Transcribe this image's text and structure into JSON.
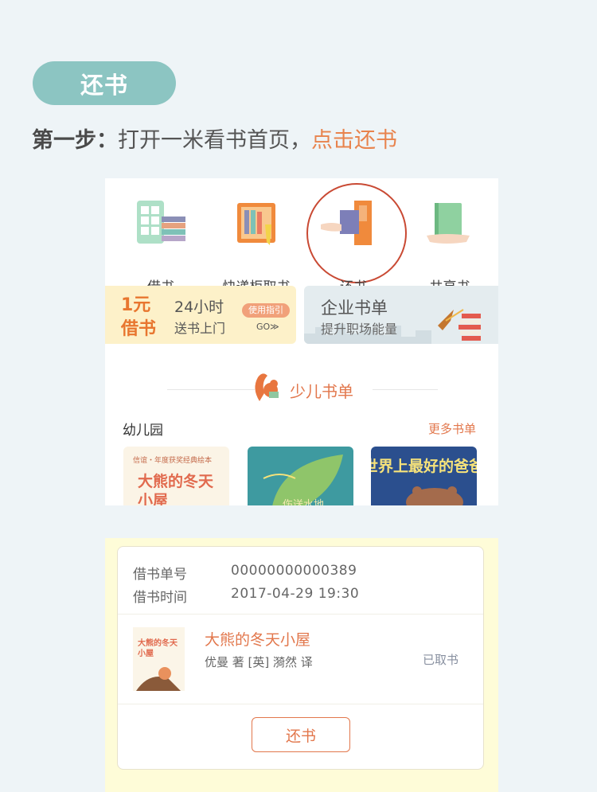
{
  "header": {
    "pill_label": "还书",
    "step_prefix": "第一步：",
    "step_text": "打开一米看书首页，",
    "step_highlight": "点击还书"
  },
  "app": {
    "menu": [
      {
        "label": "借书",
        "icon": "phone-books-icon"
      },
      {
        "label": "快递柜取书",
        "icon": "locker-icon"
      },
      {
        "label": "还书",
        "icon": "return-book-icon"
      },
      {
        "label": "共享书",
        "icon": "share-book-icon"
      }
    ],
    "banner1": {
      "big1": "1元",
      "big2": "借书",
      "line1": "24小时",
      "line2": "送书上门",
      "guide": "使用指引",
      "go": "GO≫"
    },
    "banner2": {
      "title": "企业书单",
      "sub": "提升职场能量"
    },
    "section_title": "少儿书单",
    "category": "幼儿园",
    "more": "更多书单",
    "books": [
      {
        "title": "大熊的冬天小屋",
        "caption": "信谊・年度获奖经典绘本"
      },
      {
        "title": "",
        "caption": "伤送水地"
      },
      {
        "title": "世界上最好的爸爸",
        "caption": ""
      }
    ]
  },
  "order": {
    "no_label": "借书单号",
    "no_value": "00000000000389",
    "time_label": "借书时间",
    "time_value": "2017-04-29  19:30",
    "book_title": "大熊的冬天小屋",
    "book_author": "优曼 著 [英]     漪然 译",
    "status": "已取书",
    "return_button": "还书"
  },
  "colors": {
    "accent": "#e2774c",
    "pill": "#8cc5c2",
    "circle": "#c94a34"
  }
}
